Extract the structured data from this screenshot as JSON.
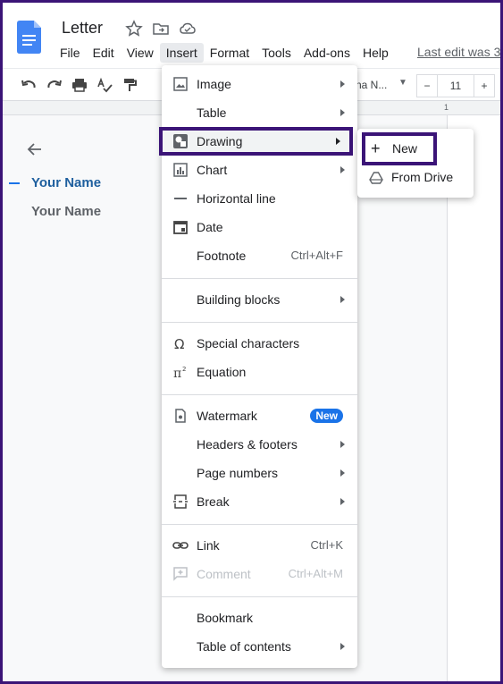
{
  "document": {
    "title": "Letter",
    "last_edit": "Last edit was 3"
  },
  "menubar": {
    "items": [
      "File",
      "Edit",
      "View",
      "Insert",
      "Format",
      "Tools",
      "Add-ons",
      "Help"
    ],
    "active": "Insert"
  },
  "toolbar": {
    "font_name": "na N...",
    "font_size": "11",
    "minus": "−",
    "plus": "+"
  },
  "ruler": {
    "marker": "1"
  },
  "outline": {
    "items": [
      "Your Name",
      "Your Name"
    ]
  },
  "insert_menu": {
    "items": [
      {
        "label": "Image",
        "icon": "image-icon",
        "submenu": true
      },
      {
        "label": "Table",
        "submenu": true
      },
      {
        "label": "Drawing",
        "icon": "drawing-icon",
        "submenu": true,
        "highlighted": true
      },
      {
        "label": "Chart",
        "icon": "chart-icon",
        "submenu": true
      },
      {
        "label": "Horizontal line",
        "icon": "horizontal-line-icon"
      },
      {
        "label": "Date",
        "icon": "calendar-icon"
      },
      {
        "label": "Footnote",
        "shortcut": "Ctrl+Alt+F"
      },
      {
        "label": "Building blocks",
        "submenu": true
      },
      {
        "label": "Special characters",
        "icon": "omega-icon"
      },
      {
        "label": "Equation",
        "icon": "pi-icon"
      },
      {
        "label": "Watermark",
        "icon": "watermark-icon",
        "badge": "New"
      },
      {
        "label": "Headers & footers",
        "submenu": true
      },
      {
        "label": "Page numbers",
        "submenu": true
      },
      {
        "label": "Break",
        "icon": "break-icon",
        "submenu": true
      },
      {
        "label": "Link",
        "icon": "link-icon",
        "shortcut": "Ctrl+K"
      },
      {
        "label": "Comment",
        "icon": "comment-icon",
        "shortcut": "Ctrl+Alt+M",
        "disabled": true
      },
      {
        "label": "Bookmark"
      },
      {
        "label": "Table of contents",
        "submenu": true
      }
    ]
  },
  "drawing_submenu": {
    "new_label": "New",
    "drive_label": "From Drive"
  },
  "colors": {
    "accent_blue": "#1a73e8",
    "highlight_border": "#3b1477",
    "outline_blue": "#1e5f9e",
    "outline_gray": "#5f6368"
  }
}
